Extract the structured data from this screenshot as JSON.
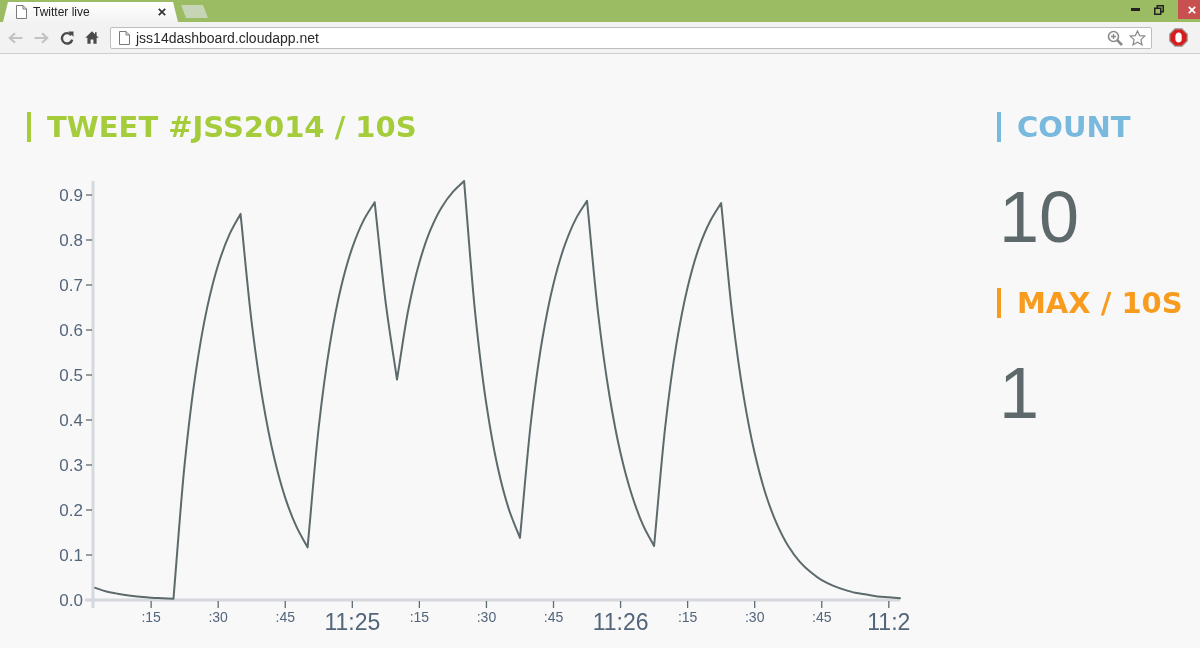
{
  "browser": {
    "tab": {
      "title": "Twitter live"
    },
    "nav_buttons": [
      {
        "kind": "back",
        "disabled": true
      },
      {
        "kind": "forward",
        "disabled": true
      },
      {
        "kind": "reload",
        "disabled": false
      },
      {
        "kind": "home",
        "disabled": false
      }
    ],
    "address": "jss14dashboard.cloudapp.net"
  },
  "sections": [
    {
      "kind": "chart",
      "heading": "TWEET #JSS2014 / 10S",
      "color": "#a5cc3a",
      "chart_data": {
        "type": "line",
        "categories": [
          null,
          null,
          null,
          null,
          null,
          ":15",
          null,
          null,
          null,
          null,
          null,
          ":30",
          null,
          null,
          null,
          null,
          null,
          ":45",
          null,
          null,
          null,
          null,
          null,
          "11:25",
          null,
          null,
          null,
          null,
          null,
          ":15",
          null,
          null,
          null,
          null,
          null,
          ":30",
          null,
          null,
          null,
          null,
          null,
          ":45",
          null,
          null,
          null,
          null,
          null,
          "11:26",
          null,
          null,
          null,
          null,
          null,
          ":15",
          null,
          null,
          null,
          null,
          null,
          ":30",
          null,
          null,
          null,
          null,
          null,
          ":45",
          null,
          null,
          null,
          null,
          null,
          "11:2",
          null
        ],
        "values": [
          0.027,
          0.019,
          0.014,
          0.01,
          0.007,
          0.005,
          0.004,
          0.003,
          0.302,
          0.507,
          0.648,
          0.745,
          0.812,
          0.858,
          0.616,
          0.442,
          0.317,
          0.227,
          0.163,
          0.117,
          0.385,
          0.569,
          0.696,
          0.783,
          0.843,
          0.884,
          0.658,
          0.49,
          0.644,
          0.75,
          0.823,
          0.873,
          0.907,
          0.931,
          0.636,
          0.434,
          0.296,
          0.202,
          0.138,
          0.4,
          0.58,
          0.703,
          0.788,
          0.847,
          0.887,
          0.635,
          0.455,
          0.326,
          0.234,
          0.167,
          0.12,
          0.386,
          0.569,
          0.695,
          0.782,
          0.841,
          0.882,
          0.633,
          0.454,
          0.326,
          0.234,
          0.168,
          0.12,
          0.086,
          0.062,
          0.044,
          0.032,
          0.023,
          0.016,
          0.012,
          0.008,
          0.006,
          0.004
        ],
        "ylim": [
          0,
          0.931
        ],
        "yticks": [
          {
            "value": 0,
            "label": "0.0"
          },
          {
            "value": 0.1,
            "label": "0.1"
          },
          {
            "value": 0.2,
            "label": "0.2"
          },
          {
            "value": 0.3,
            "label": "0.3"
          },
          {
            "value": 0.4,
            "label": "0.4"
          },
          {
            "value": 0.5,
            "label": "0.5"
          },
          {
            "value": 0.6,
            "label": "0.6"
          },
          {
            "value": 0.7,
            "label": "0.7"
          },
          {
            "value": 0.8,
            "label": "0.8"
          },
          {
            "value": 0.9,
            "label": "0.9"
          }
        ]
      },
      "x_label_large": [
        false,
        false,
        false,
        true,
        false,
        false,
        false,
        true,
        false,
        false,
        false,
        true
      ]
    },
    {
      "kind": "stat",
      "heading": "COUNT",
      "value": "10",
      "color": "#7ab9de"
    },
    {
      "kind": "stat",
      "heading": "MAX / 10S",
      "value": "1",
      "color": "#f79c1e"
    }
  ]
}
